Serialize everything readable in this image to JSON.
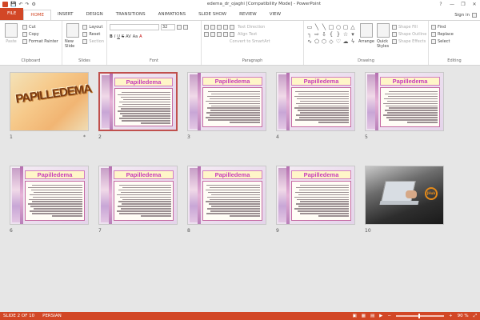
{
  "window": {
    "title": "edema_dr_ojaghi [Compatibility Mode] - PowerPoint",
    "help": "?",
    "minimize": "—",
    "restore": "❐",
    "close": "✕"
  },
  "qat": {
    "save": "💾",
    "undo": "↶",
    "redo": "↷",
    "customize": "⚙"
  },
  "tabs": [
    "FILE",
    "HOME",
    "INSERT",
    "DESIGN",
    "TRANSITIONS",
    "ANIMATIONS",
    "SLIDE SHOW",
    "REVIEW",
    "VIEW"
  ],
  "active_tab": "HOME",
  "sign_in": "Sign in",
  "ribbon": {
    "clipboard": {
      "label": "Clipboard",
      "paste": "Paste",
      "cut": "Cut",
      "copy": "Copy",
      "format_painter": "Format Painter"
    },
    "slides": {
      "label": "Slides",
      "new_slide": "New Slide",
      "layout": "Layout",
      "reset": "Reset",
      "section": "Section"
    },
    "font": {
      "label": "Font",
      "size": "32"
    },
    "paragraph": {
      "label": "Paragraph",
      "text_direction": "Text Direction",
      "align_text": "Align Text",
      "convert_smartart": "Convert to SmartArt"
    },
    "drawing": {
      "label": "Drawing",
      "arrange": "Arrange",
      "quick_styles": "Quick Styles",
      "shape_fill": "Shape Fill",
      "shape_outline": "Shape Outline",
      "shape_effects": "Shape Effects"
    },
    "editing": {
      "label": "Editing",
      "find": "Find",
      "replace": "Replace",
      "select": "Select"
    }
  },
  "slides": [
    {
      "num": "1",
      "title": "PAPILLEDEMA",
      "star": "*"
    },
    {
      "num": "2",
      "title": "Papilledema"
    },
    {
      "num": "3",
      "title": "Papilledema"
    },
    {
      "num": "4",
      "title": "Papilledema"
    },
    {
      "num": "5",
      "title": "Papilledema"
    },
    {
      "num": "6",
      "title": "Papilledema"
    },
    {
      "num": "7",
      "title": "Papilledema"
    },
    {
      "num": "8",
      "title": "Papilledema"
    },
    {
      "num": "9",
      "title": "Papilledema"
    },
    {
      "num": "10",
      "title": "",
      "logo": "JHub"
    }
  ],
  "selected_slide": 2,
  "status": {
    "slide_info": "SLIDE 2 OF 10",
    "language": "PERSIAN",
    "zoom": "90 %"
  }
}
